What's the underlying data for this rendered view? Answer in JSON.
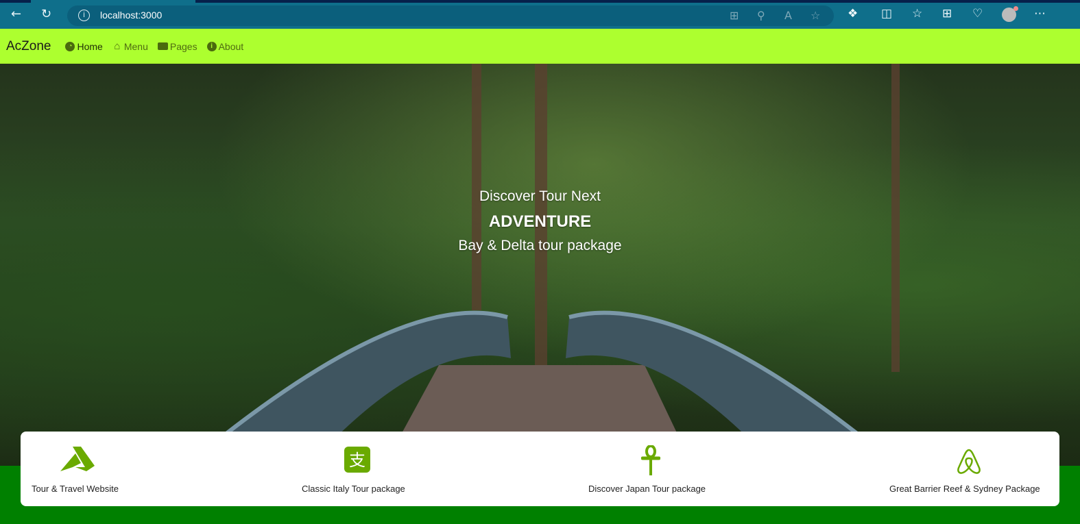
{
  "browser": {
    "url": "localhost:3000"
  },
  "nav": {
    "brand": "AcZone",
    "items": [
      {
        "label": "Home",
        "icon": "dashboard-icon"
      },
      {
        "label": "Menu",
        "icon": "home-icon"
      },
      {
        "label": "Pages",
        "icon": "tablet-icon"
      },
      {
        "label": "About",
        "icon": "info-icon"
      }
    ]
  },
  "hero": {
    "line1": "Discover Tour Next",
    "line2": "ADVENTURE",
    "line3": "Bay & Delta tour package"
  },
  "features": [
    {
      "label": "Tour & Travel Website",
      "icon": "tour-logo-icon"
    },
    {
      "label": "Classic Italy Tour package",
      "icon": "alipay-icon"
    },
    {
      "label": "Discover Japan Tour package",
      "icon": "ankh-icon"
    },
    {
      "label": "Great Barrier Reef & Sydney Package",
      "icon": "airbnb-icon"
    }
  ],
  "colors": {
    "nav_bg": "#adff2f",
    "footer_bg": "#008000",
    "accent": "#6aaa00"
  }
}
